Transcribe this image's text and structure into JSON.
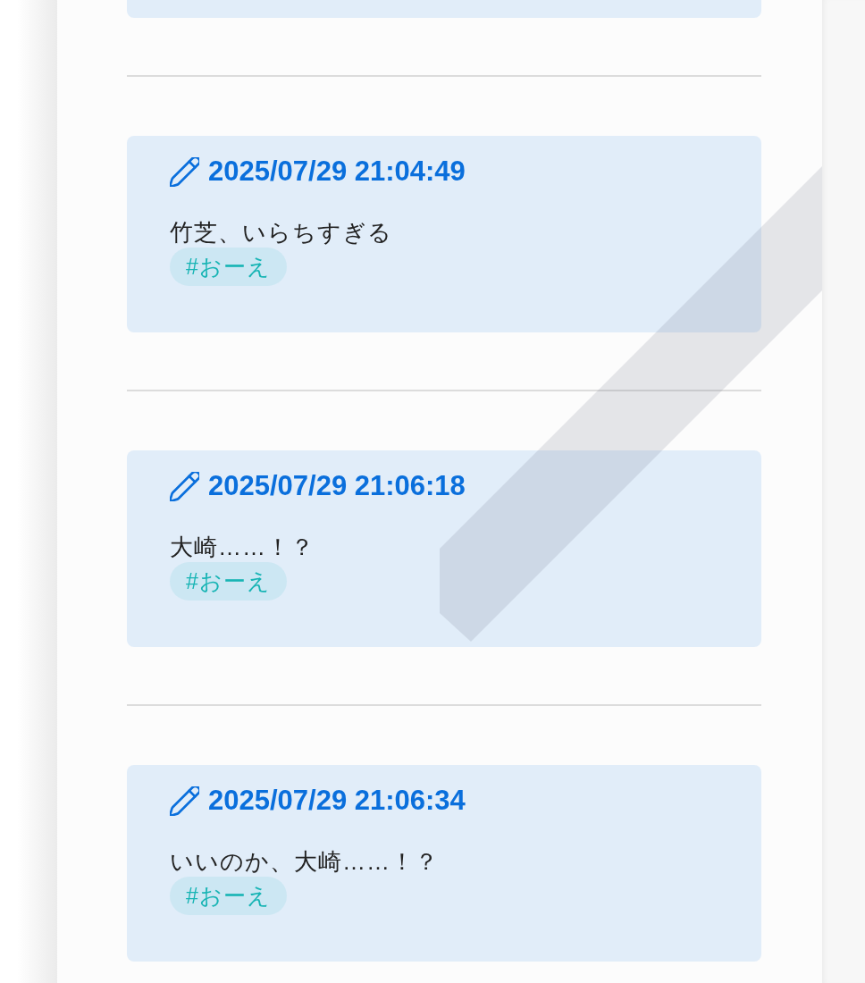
{
  "entries": [
    {
      "timestamp": "2025/07/29 21:04:49",
      "text": "竹芝、いらちすぎる",
      "tags": [
        "#おーえ"
      ]
    },
    {
      "timestamp": "2025/07/29 21:06:18",
      "text": "大崎……！？",
      "tags": [
        "#おーえ"
      ]
    },
    {
      "timestamp": "2025/07/29 21:06:34",
      "text": "いいのか、大崎……！？",
      "tags": [
        "#おーえ"
      ]
    }
  ]
}
